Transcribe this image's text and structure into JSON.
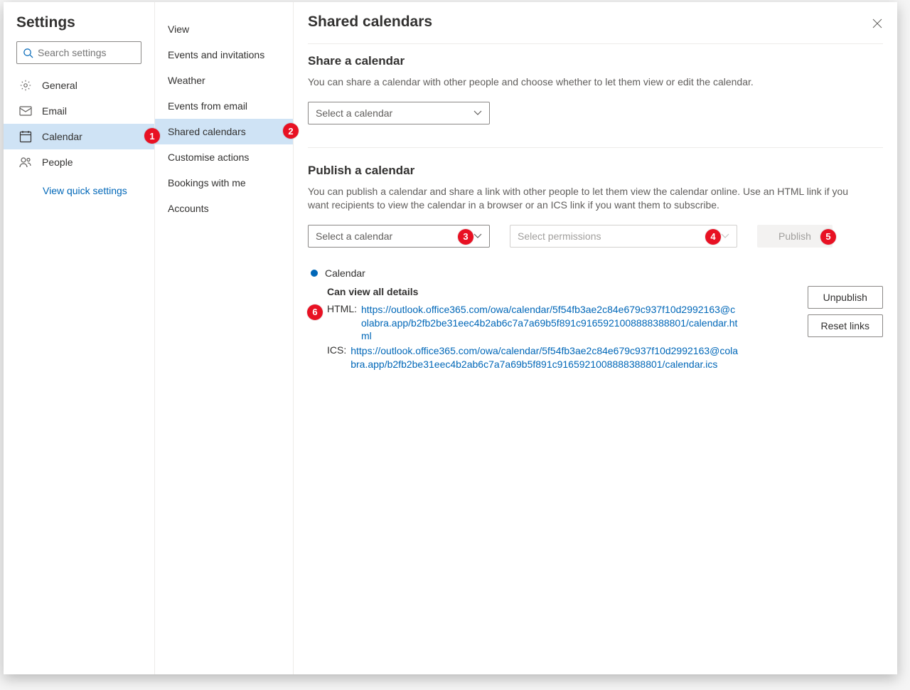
{
  "header": {
    "title": "Settings",
    "search_placeholder": "Search settings",
    "quick_settings": "View quick settings"
  },
  "nav": {
    "general": "General",
    "email": "Email",
    "calendar": "Calendar",
    "people": "People"
  },
  "subnav": {
    "view": "View",
    "events_invitations": "Events and invitations",
    "weather": "Weather",
    "events_from_email": "Events from email",
    "shared_calendars": "Shared calendars",
    "customise_actions": "Customise actions",
    "bookings": "Bookings with me",
    "accounts": "Accounts"
  },
  "main": {
    "title": "Shared calendars",
    "share_section": {
      "title": "Share a calendar",
      "desc": "You can share a calendar with other people and choose whether to let them view or edit the calendar.",
      "select_placeholder": "Select a calendar"
    },
    "publish_section": {
      "title": "Publish a calendar",
      "desc": "You can publish a calendar and share a link with other people to let them view the calendar online. Use an HTML link if you want recipients to view the calendar in a browser or an ICS link if you want them to subscribe.",
      "select_calendar": "Select a calendar",
      "select_permissions": "Select permissions",
      "publish_btn": "Publish"
    },
    "published": {
      "name": "Calendar",
      "permission": "Can view all details",
      "html_label": "HTML:",
      "ics_label": "ICS:",
      "html_url": "https://outlook.office365.com/owa/calendar/5f54fb3ae2c84e679c937f10d2992163@colabra.app/b2fb2be31eec4b2ab6c7a7a69b5f891c9165921008888388801/calendar.html",
      "ics_url": "https://outlook.office365.com/owa/calendar/5f54fb3ae2c84e679c937f10d2992163@colabra.app/b2fb2be31eec4b2ab6c7a7a69b5f891c9165921008888388801/calendar.ics",
      "unpublish_btn": "Unpublish",
      "reset_btn": "Reset links"
    }
  },
  "annotations": [
    "1",
    "2",
    "3",
    "4",
    "5",
    "6"
  ]
}
